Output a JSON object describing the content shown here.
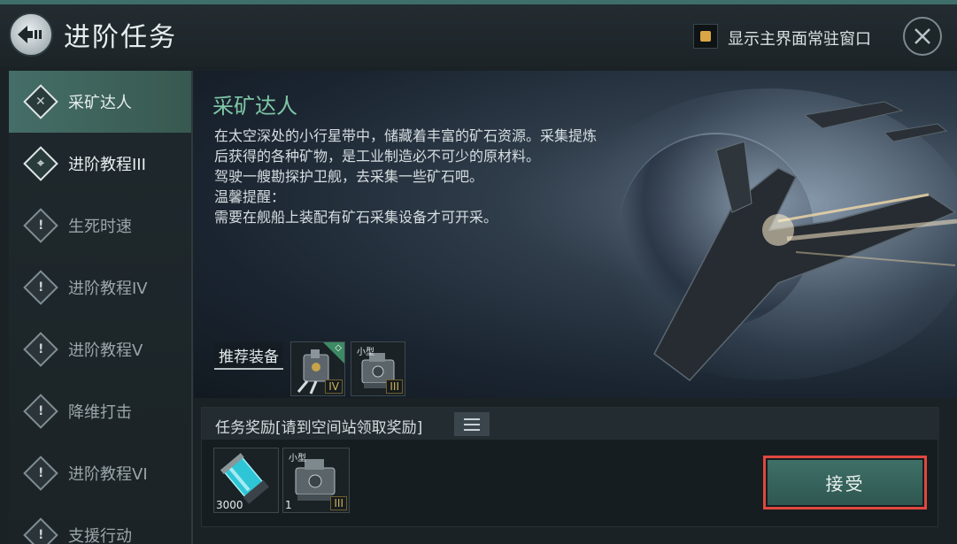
{
  "header": {
    "title": "进阶任务",
    "toggle_label": "显示主界面常驻窗口",
    "toggle_color": "#d9a545"
  },
  "sidebar": {
    "items": [
      {
        "label": "采矿达人",
        "state": "active",
        "icon": "mining-crossed-tools-icon"
      },
      {
        "label": "进阶教程III",
        "state": "bright",
        "icon": "target-crosshair-icon"
      },
      {
        "label": "生死时速",
        "state": "locked",
        "icon": "exclamation-diamond-icon"
      },
      {
        "label": "进阶教程IV",
        "state": "locked",
        "icon": "exclamation-diamond-icon"
      },
      {
        "label": "进阶教程V",
        "state": "locked",
        "icon": "exclamation-diamond-icon"
      },
      {
        "label": "降维打击",
        "state": "locked",
        "icon": "exclamation-diamond-icon"
      },
      {
        "label": "进阶教程VI",
        "state": "locked",
        "icon": "exclamation-diamond-icon"
      },
      {
        "label": "支援行动",
        "state": "locked",
        "icon": "exclamation-diamond-icon"
      }
    ]
  },
  "mission": {
    "name": "采矿达人",
    "description": "在太空深处的小行星带中，储藏着丰富的矿石资源。采集提炼\n后获得的各种矿物，是工业制造必不可少的原材料。\n驾驶一艘勘探护卫舰，去采集一些矿石吧。\n温馨提醒：\n需要在舰船上装配有矿石采集设备才可开采。"
  },
  "recommended": {
    "label": "推荐装备",
    "items": [
      {
        "icon": "mining-laser-module-icon",
        "tier": "IV",
        "badge": "◇"
      },
      {
        "icon": "small-ship-module-icon",
        "tier": "III",
        "size_label": "小型"
      }
    ]
  },
  "rewards": {
    "title": "任务奖励[请到空间站领取奖励]",
    "items": [
      {
        "icon": "energy-canister-icon",
        "quantity": "3000"
      },
      {
        "icon": "small-ship-module-icon",
        "quantity": "1",
        "tier": "III",
        "size_label": "小型"
      }
    ]
  },
  "actions": {
    "accept_label": "接受",
    "accept_highlight_color": "#e0483f"
  }
}
